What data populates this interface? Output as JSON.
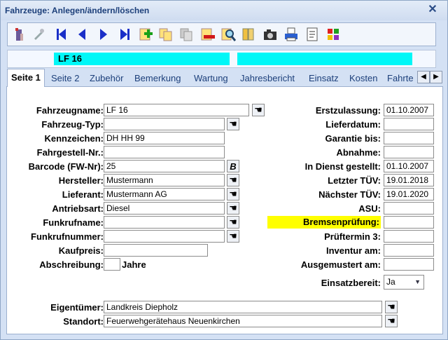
{
  "window": {
    "title": "Fahrzeuge: Anlegen/ändern/löschen",
    "close_glyph": "✕"
  },
  "toolbar": {
    "buttons": [
      {
        "name": "exit-icon"
      },
      {
        "name": "tools-icon"
      },
      {
        "name": "first-record-icon"
      },
      {
        "name": "previous-record-icon"
      },
      {
        "name": "next-record-icon"
      },
      {
        "name": "last-record-icon"
      },
      {
        "name": "add-record-icon"
      },
      {
        "name": "copy-record-icon"
      },
      {
        "name": "paste-record-icon"
      },
      {
        "name": "delete-record-icon"
      },
      {
        "name": "search-icon"
      },
      {
        "name": "documents-icon"
      },
      {
        "name": "camera-icon"
      },
      {
        "name": "print-icon"
      },
      {
        "name": "report-icon"
      },
      {
        "name": "color-settings-icon"
      }
    ]
  },
  "status": {
    "vehicle": "LF 16",
    "second": ""
  },
  "tabs": [
    "Seite 1",
    "Seite 2",
    "Zubehör",
    "Bemerkung",
    "Wartung",
    "Jahresbericht",
    "Einsatz",
    "Kosten",
    "Fahrte"
  ],
  "form": {
    "fahrzeugname": {
      "label": "Fahrzeugname:",
      "value": "LF 16"
    },
    "fahrzeug_typ": {
      "label": "Fahrzeug-Typ:",
      "value": ""
    },
    "kennzeichen": {
      "label": "Kennzeichen:",
      "value": "DH HH 99"
    },
    "fahrgestell": {
      "label": "Fahrgestell-Nr.:",
      "value": ""
    },
    "barcode": {
      "label": "Barcode (FW-Nr):",
      "value": "25",
      "button": "B"
    },
    "hersteller": {
      "label": "Hersteller:",
      "value": "Mustermann"
    },
    "lieferant": {
      "label": "Lieferant:",
      "value": "Mustermann AG"
    },
    "antriebsart": {
      "label": "Antriebsart:",
      "value": "Diesel"
    },
    "funkrufname": {
      "label": "Funkrufname:",
      "value": ""
    },
    "funkrufnummer": {
      "label": "Funkrufnummer:",
      "value": ""
    },
    "kaufpreis": {
      "label": "Kaufpreis:",
      "value": ""
    },
    "abschreibung": {
      "label": "Abschreibung:",
      "value": "",
      "unit": "Jahre"
    },
    "erstzulassung": {
      "label": "Erstzulassung:",
      "value": "01.10.2007"
    },
    "lieferdatum": {
      "label": "Lieferdatum:",
      "value": ""
    },
    "garantie": {
      "label": "Garantie bis:",
      "value": ""
    },
    "abnahme": {
      "label": "Abnahme:",
      "value": ""
    },
    "in_dienst": {
      "label": "In Dienst gestellt:",
      "value": "01.10.2007"
    },
    "letzter_tuev": {
      "label": "Letzter TÜV:",
      "value": "19.01.2018"
    },
    "naechster_tuev": {
      "label": "Nächster TÜV:",
      "value": "19.01.2020"
    },
    "asu": {
      "label": "ASU:",
      "value": ""
    },
    "bremsen": {
      "label": "Bremsenprüfung:",
      "value": "",
      "highlight_color": "#ffff00"
    },
    "pruef3": {
      "label": "Prüftermin 3:",
      "value": ""
    },
    "inventur": {
      "label": "Inventur am:",
      "value": ""
    },
    "ausgemustert": {
      "label": "Ausgemustert am:",
      "value": ""
    },
    "einsatzbereit": {
      "label": "Einsatzbereit:",
      "value": "Ja"
    },
    "eigentuemer": {
      "label": "Eigentümer:",
      "value": "Landkreis Diepholz"
    },
    "standort": {
      "label": "Standort:",
      "value": "Feuerwehgerätehaus Neuenkirchen"
    }
  },
  "colors": {
    "accent_cyan": "#00f7f7",
    "nav_blue": "#1a2fc8"
  }
}
